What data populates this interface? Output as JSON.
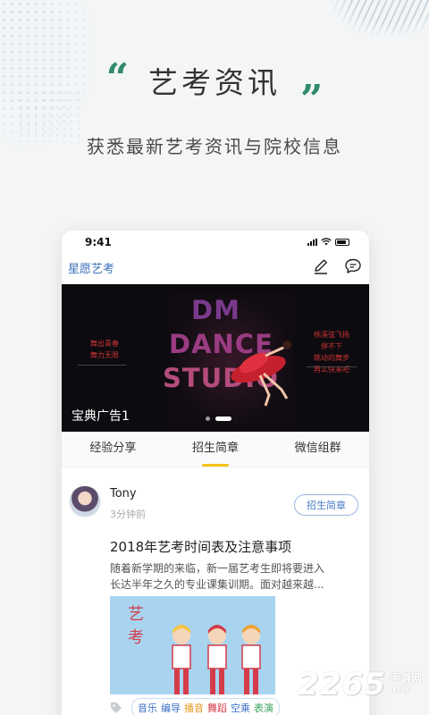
{
  "hero": {
    "quote_open": "“",
    "title": "艺考资讯",
    "quote_close": "”",
    "subtitle": "获悉最新艺考资讯与院校信息"
  },
  "phone": {
    "status_time": "9:41",
    "app_name": "星愿艺考",
    "icons": [
      "edit-icon",
      "chat-icon"
    ],
    "banner": {
      "word1": "DM",
      "word2": "DANCE",
      "word3": "STUDIO",
      "left_lines": [
        "舞出青春",
        "舞力无限"
      ],
      "right_lines": [
        "桃溪弦飞扬",
        "停不下",
        "跳动的舞步",
        "再么快来吧"
      ],
      "caption": "宝典广告1"
    },
    "tabs": [
      {
        "label": "经验分享",
        "active": false
      },
      {
        "label": "招生简章",
        "active": true
      },
      {
        "label": "微信组群",
        "active": false
      }
    ],
    "post": {
      "username": "Tony",
      "time": "3分钟前",
      "category": "招生简章",
      "title": "2018年艺考时间表及注意事项",
      "excerpt_line1": "随着新学期的来临，新一届艺考生即将要进入",
      "excerpt_line2": "长达半年之久的专业课集训期。面对越来越...",
      "image_text": "艺考",
      "tags": [
        {
          "label": "音乐",
          "color": "#3b6fc4"
        },
        {
          "label": "编导",
          "color": "#3b6fc4"
        },
        {
          "label": "播音",
          "color": "#e39a1b"
        },
        {
          "label": "舞蹈",
          "color": "#d43c4a"
        },
        {
          "label": "空乘",
          "color": "#3b6fc4"
        },
        {
          "label": "表演",
          "color": "#3aa05a"
        }
      ]
    }
  },
  "watermark": {
    "number": "2265",
    "suffix": ".com",
    "text": "手游网"
  },
  "colors": {
    "accent_green": "#2f8a6c",
    "tab_indicator": "#f5c518",
    "link_blue": "#3a6fb8"
  }
}
